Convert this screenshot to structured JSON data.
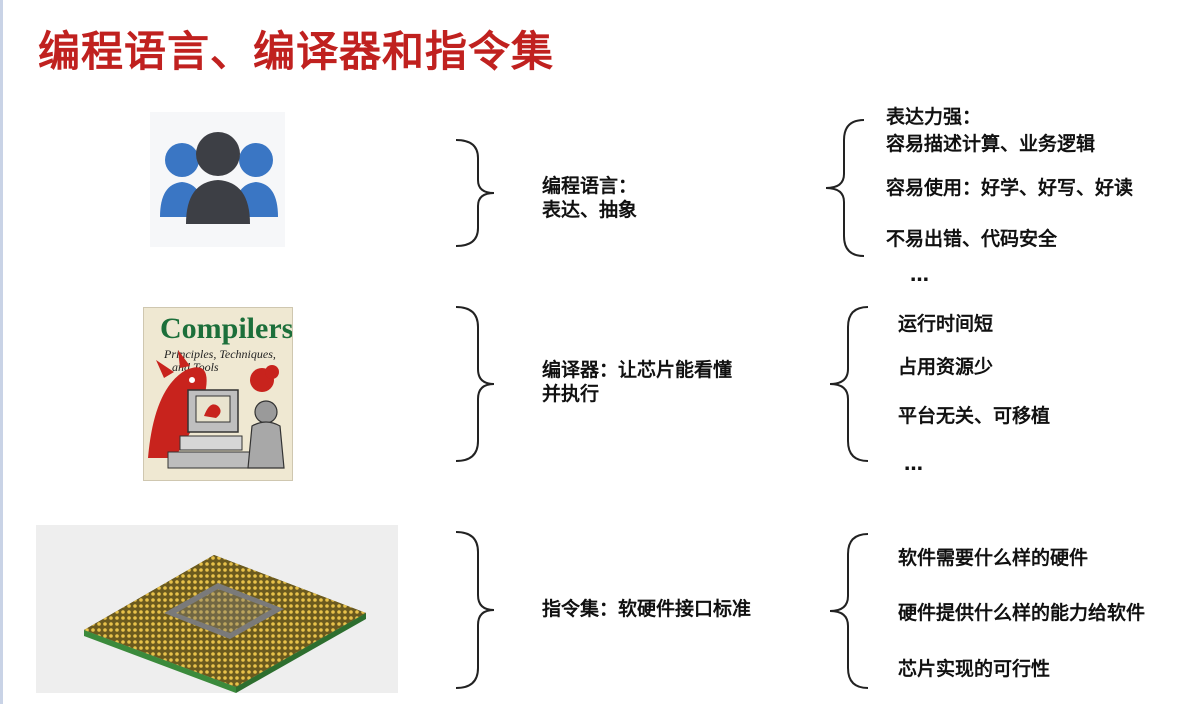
{
  "title": "编程语言、编译器和指令集",
  "sections": [
    {
      "middle": [
        "编程语言：",
        "表达、抽象"
      ],
      "items": [
        "表达力强：",
        "容易描述计算、业务逻辑",
        "容易使用：好学、好写、好读",
        "不易出错、代码安全",
        "…"
      ]
    },
    {
      "middle": [
        "编译器：让芯片能看懂",
        "并执行"
      ],
      "items": [
        "运行时间短",
        "占用资源少",
        "平台无关、可移植",
        "…"
      ]
    },
    {
      "middle": [
        "指令集：软硬件接口标准"
      ],
      "items": [
        "软件需要什么样的硬件",
        "硬件提供什么样的能力给软件",
        "芯片实现的可行性"
      ]
    }
  ],
  "book": {
    "title": "Compilers",
    "subtitle_line1": "Principles, Techniques,",
    "subtitle_line2": "and Tools"
  },
  "colors": {
    "title": "#c0211f",
    "people_blue": "#3a76c4",
    "people_dark": "#3d3f45",
    "book_green": "#1c6f3a",
    "dragon_red": "#c8231d"
  }
}
